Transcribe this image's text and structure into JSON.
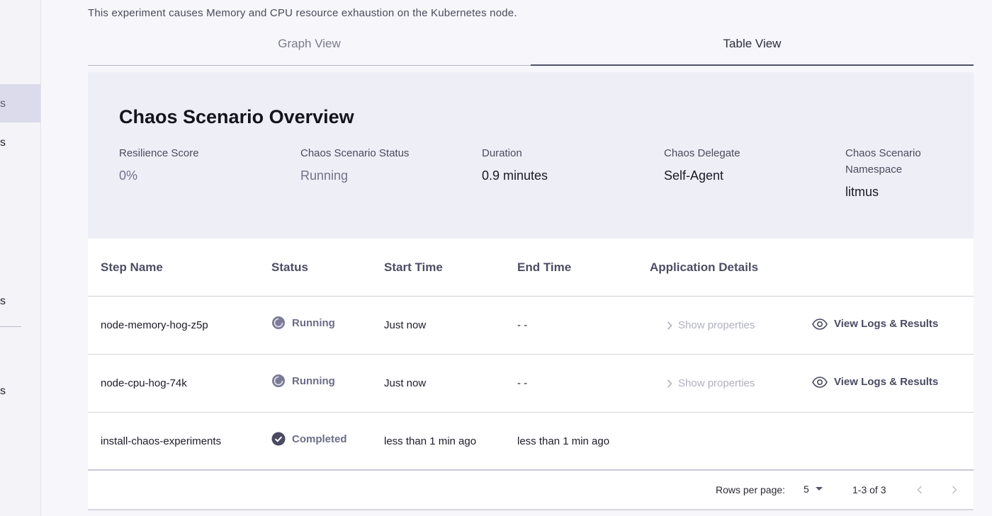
{
  "sidebar": {
    "items": [
      {
        "label": "s"
      },
      {
        "label": "s"
      },
      {
        "label": "s"
      },
      {
        "label": "s"
      }
    ]
  },
  "description": "This experiment causes Memory and CPU resource exhaustion on the Kubernetes node.",
  "tabs": [
    {
      "label": "Graph View",
      "active": false
    },
    {
      "label": "Table View",
      "active": true
    }
  ],
  "overview": {
    "title": "Chaos Scenario Overview",
    "fields": [
      {
        "label": "Resilience Score",
        "value": "0%"
      },
      {
        "label": "Chaos Scenario Status",
        "value": "Running"
      },
      {
        "label": "Duration",
        "value": "0.9 minutes"
      },
      {
        "label": "Chaos Delegate",
        "value": "Self-Agent"
      },
      {
        "label": "Chaos Scenario Namespace",
        "value": "litmus"
      }
    ]
  },
  "table": {
    "headers": [
      "Step Name",
      "Status",
      "Start Time",
      "End Time",
      "Application Details"
    ],
    "rows": [
      {
        "step": "node-memory-hog-z5p",
        "status": "Running",
        "start": "Just now",
        "end": "- -",
        "details": "Show properties",
        "logs": "View Logs & Results"
      },
      {
        "step": "node-cpu-hog-74k",
        "status": "Running",
        "start": "Just now",
        "end": "- -",
        "details": "Show properties",
        "logs": "View Logs & Results"
      },
      {
        "step": "install-chaos-experiments",
        "status": "Completed",
        "start": "less than 1 min ago",
        "end": "less than 1 min ago"
      }
    ],
    "pagination": {
      "rows_per_page_label": "Rows per page:",
      "rows_per_page": "5",
      "range": "1-3 of 3"
    }
  },
  "colors": {
    "accent": "#51516a",
    "overview_bg": "#eeeef7",
    "status_running": "#6c6c88",
    "status_completed": "#4a4a62"
  }
}
